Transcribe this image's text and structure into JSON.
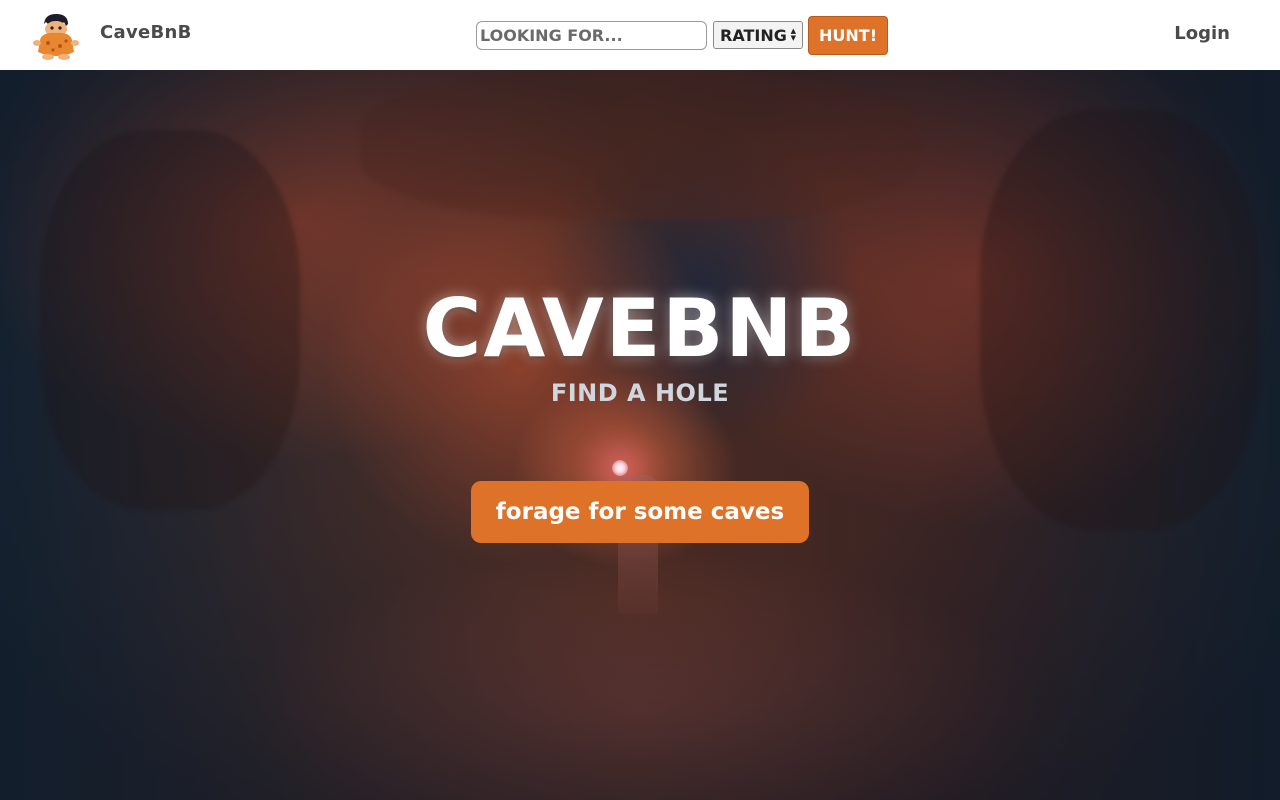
{
  "navbar": {
    "brand": "CaveBnB",
    "search_placeholder": "LOOKING FOR...",
    "rating_label": "RATING",
    "hunt_label": "HUNT!",
    "login_label": "Login"
  },
  "hero": {
    "title": "CAVEBNB",
    "subtitle": "FIND A HOLE",
    "cta_label": "forage for some caves"
  },
  "colors": {
    "accent": "#de7228",
    "nav_text": "#4a4a4a",
    "hero_title": "#ffffff"
  },
  "icons": {
    "logo": "caveman-mascot-icon",
    "select_arrows": "updown-arrows-icon"
  }
}
